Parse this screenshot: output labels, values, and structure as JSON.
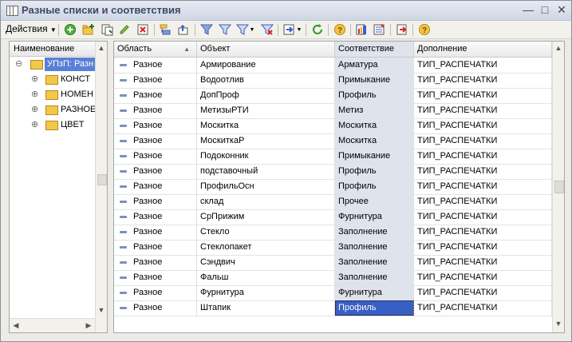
{
  "window": {
    "title": "Разные списки и соответствия"
  },
  "toolbar": {
    "actions_label": "Действия"
  },
  "left_pane": {
    "header": "Наименование",
    "root": "УПзП: Разн",
    "items": [
      "КОНСТ",
      "НОМЕН",
      "РАЗНОЕ",
      "ЦВЕТ"
    ]
  },
  "grid": {
    "columns": [
      "Область",
      "Объект",
      "Соответствие",
      "Дополнение"
    ],
    "rows": [
      [
        "Разное",
        "Армирование",
        "Арматура",
        "ТИП_РАСПЕЧАТКИ"
      ],
      [
        "Разное",
        "Водоотлив",
        "Примыкание",
        "ТИП_РАСПЕЧАТКИ"
      ],
      [
        "Разное",
        "ДопПроф",
        "Профиль",
        "ТИП_РАСПЕЧАТКИ"
      ],
      [
        "Разное",
        "МетизыРТИ",
        "Метиз",
        "ТИП_РАСПЕЧАТКИ"
      ],
      [
        "Разное",
        "Москитка",
        "Москитка",
        "ТИП_РАСПЕЧАТКИ"
      ],
      [
        "Разное",
        "МоскиткаР",
        "Москитка",
        "ТИП_РАСПЕЧАТКИ"
      ],
      [
        "Разное",
        "Подоконник",
        "Примыкание",
        "ТИП_РАСПЕЧАТКИ"
      ],
      [
        "Разное",
        "подставочный",
        "Профиль",
        "ТИП_РАСПЕЧАТКИ"
      ],
      [
        "Разное",
        "ПрофильОсн",
        "Профиль",
        "ТИП_РАСПЕЧАТКИ"
      ],
      [
        "Разное",
        "склад",
        "Прочее",
        "ТИП_РАСПЕЧАТКИ"
      ],
      [
        "Разное",
        "СрПрижим",
        "Фурнитура",
        "ТИП_РАСПЕЧАТКИ"
      ],
      [
        "Разное",
        "Стекло",
        "Заполнение",
        "ТИП_РАСПЕЧАТКИ"
      ],
      [
        "Разное",
        "Стеклопакет",
        "Заполнение",
        "ТИП_РАСПЕЧАТКИ"
      ],
      [
        "Разное",
        "Сэндвич",
        "Заполнение",
        "ТИП_РАСПЕЧАТКИ"
      ],
      [
        "Разное",
        "Фальш",
        "Заполнение",
        "ТИП_РАСПЕЧАТКИ"
      ],
      [
        "Разное",
        "Фурнитура",
        "Фурнитура",
        "ТИП_РАСПЕЧАТКИ"
      ],
      [
        "Разное",
        "Штапик",
        "Профиль",
        "ТИП_РАСПЕЧАТКИ"
      ]
    ],
    "active_row": 16,
    "active_col": 2
  },
  "colors": {
    "grid_highlight_col": "#dfe3ec",
    "selection": "#3a5fc4",
    "tree_selection": "#5a7fd6",
    "folder": "#f2c84b"
  }
}
